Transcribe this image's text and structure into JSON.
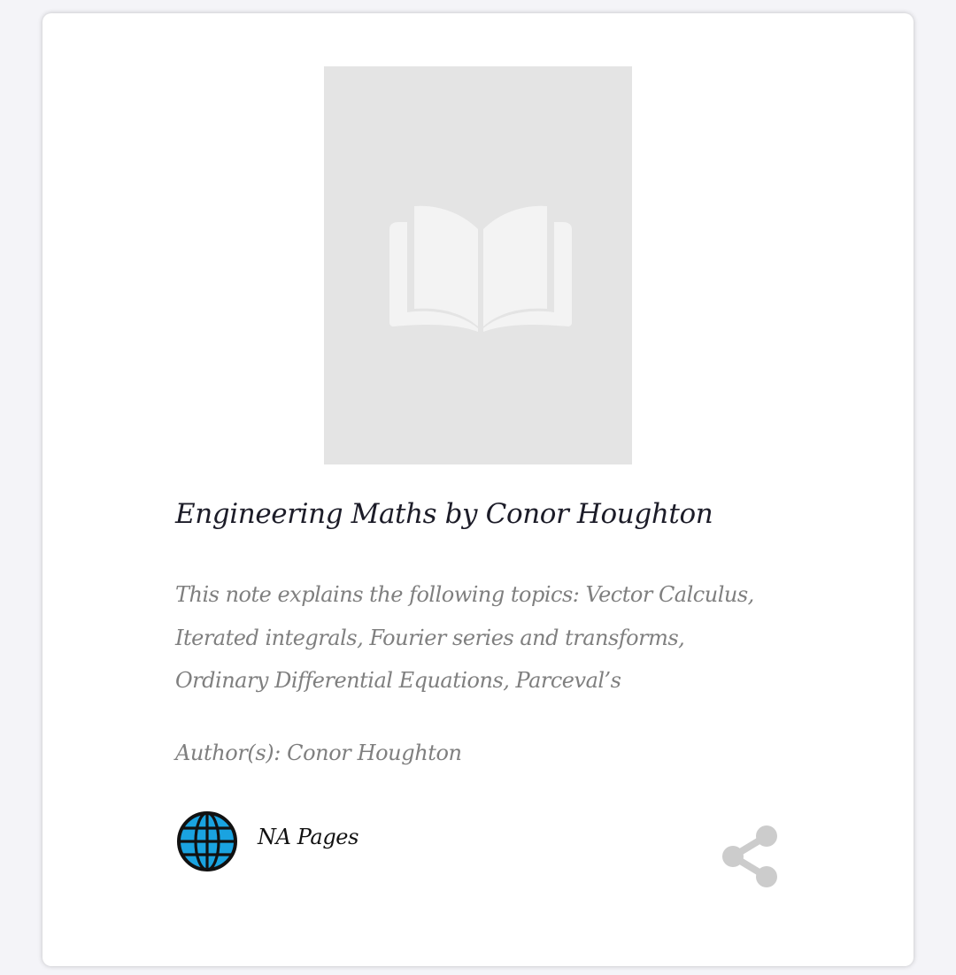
{
  "book": {
    "title": "Engineering Maths by Conor Houghton",
    "description": "This note explains the following topics: Vector Calculus, Iterated integrals, Fourier series and transforms, Ordinary Differential Equations, Parceval’s",
    "author_line": "Author(s): Conor Houghton",
    "pages_label": "NA Pages"
  },
  "icons": {
    "cover_placeholder": "open-book-icon",
    "pages": "globe-icon",
    "share": "share-icon"
  },
  "colors": {
    "card_background": "#ffffff",
    "page_background": "#f4f4f8",
    "cover_placeholder": "#e4e4e4",
    "title_text": "#1c1c28",
    "muted_text": "#7f7f7f",
    "globe_fill": "#1aa3e0",
    "share_icon": "#cccccc"
  }
}
